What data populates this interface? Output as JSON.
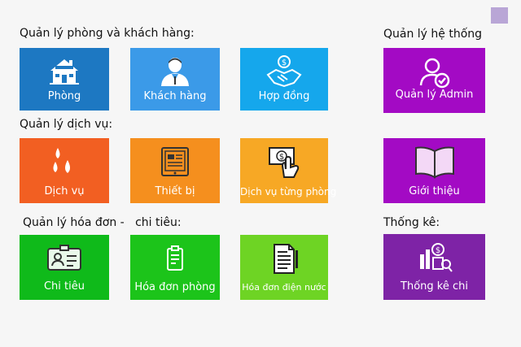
{
  "sections": {
    "rooms_customers": "Quản lý phòng và khách hàng:",
    "system": "Quản lý hệ thống",
    "services": "Quản lý dịch vụ:",
    "invoices": "Quản lý hóa đơn -   chi tiêu:",
    "stats": "Thống kê:"
  },
  "tiles": {
    "phong": {
      "label": "Phòng",
      "icon": "house-icon",
      "color": "#1d78c2"
    },
    "khach_hang": {
      "label": "Khách hàng",
      "icon": "customer-icon",
      "color": "#3b9ae8"
    },
    "hop_dong": {
      "label": "Hợp đồng",
      "icon": "handshake-dollar-icon",
      "color": "#15a7ec"
    },
    "quan_ly_admin": {
      "label": "Quản lý Admin",
      "icon": "admin-user-check-icon",
      "color": "#a30ac4"
    },
    "dich_vu": {
      "label": "Dịch vụ",
      "icon": "water-drops-icon",
      "color": "#f25f22"
    },
    "thiet_bi": {
      "label": "Thiết bị",
      "icon": "tablet-device-icon",
      "color": "#f58f1e"
    },
    "dich_vu_tung_phong": {
      "label": "Dịch vụ từng phòng",
      "icon": "hand-money-icon",
      "color": "#f7a825"
    },
    "gioi_thieu": {
      "label": "Giới thiệu",
      "icon": "open-book-icon",
      "color": "#a30ac4"
    },
    "chi_tieu": {
      "label": "Chi tiêu",
      "icon": "id-card-icon",
      "color": "#0fba1a"
    },
    "hoa_don_phong": {
      "label": "Hóa đơn phòng",
      "icon": "clipboard-icon",
      "color": "#1cc41a"
    },
    "hoa_don_dien_nuoc": {
      "label": "Hóa đơn điện nước",
      "icon": "document-pen-icon",
      "color": "#6ed424"
    },
    "thong_ke_chi": {
      "label": "Thống kê chi",
      "icon": "stats-money-icon",
      "color": "#7e23a6"
    }
  }
}
